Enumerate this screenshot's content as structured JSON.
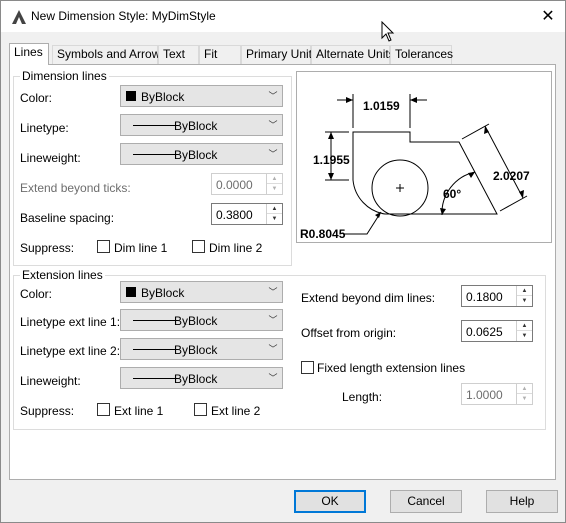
{
  "window": {
    "title": "New Dimension Style: MyDimStyle",
    "close_glyph": "✕"
  },
  "tabs": [
    {
      "label": "Lines",
      "active": true
    },
    {
      "label": "Symbols and Arrows",
      "active": false
    },
    {
      "label": "Text",
      "active": false
    },
    {
      "label": "Fit",
      "active": false
    },
    {
      "label": "Primary Units",
      "active": false
    },
    {
      "label": "Alternate Units",
      "active": false
    },
    {
      "label": "Tolerances",
      "active": false
    }
  ],
  "dimension_lines": {
    "group_label": "Dimension lines",
    "color_label": "Color:",
    "color_value": "ByBlock",
    "linetype_label": "Linetype:",
    "linetype_value": "ByBlock",
    "lineweight_label": "Lineweight:",
    "lineweight_value": "ByBlock",
    "extend_label": "Extend beyond ticks:",
    "extend_value": "0.0000",
    "baseline_label": "Baseline spacing:",
    "baseline_value": "0.3800",
    "suppress_label": "Suppress:",
    "dim_line1_label": "Dim line 1",
    "dim_line2_label": "Dim line 2"
  },
  "extension_lines": {
    "group_label": "Extension lines",
    "color_label": "Color:",
    "color_value": "ByBlock",
    "ext1_label": "Linetype ext line 1:",
    "ext1_value": "ByBlock",
    "ext2_label": "Linetype ext line 2:",
    "ext2_value": "ByBlock",
    "lineweight_label": "Lineweight:",
    "lineweight_value": "ByBlock",
    "suppress_label": "Suppress:",
    "ext_line1_label": "Ext line 1",
    "ext_line2_label": "Ext line 2",
    "extend_dim_label": "Extend beyond dim lines:",
    "extend_dim_value": "0.1800",
    "offset_label": "Offset from origin:",
    "offset_value": "0.0625",
    "fixed_length_label": "Fixed length extension lines",
    "length_label": "Length:",
    "length_value": "1.0000"
  },
  "preview": {
    "dim_top": "1.0159",
    "dim_left": "1.1955",
    "dim_right": "2.0207",
    "angle": "60°",
    "radius": "R0.8045"
  },
  "buttons": {
    "ok": "OK",
    "cancel": "Cancel",
    "help": "Help"
  },
  "icons": {
    "app": "autocad-dimension-icon",
    "close": "close-icon",
    "cursor": "mouse-cursor-icon",
    "dropdown": "chevron-down-icon",
    "spin_up": "spin-up-icon",
    "spin_down": "spin-down-icon"
  },
  "colors": {
    "accent": "#0078d7",
    "panel_bg": "#ffffff",
    "window_bg": "#f0f0f0"
  }
}
